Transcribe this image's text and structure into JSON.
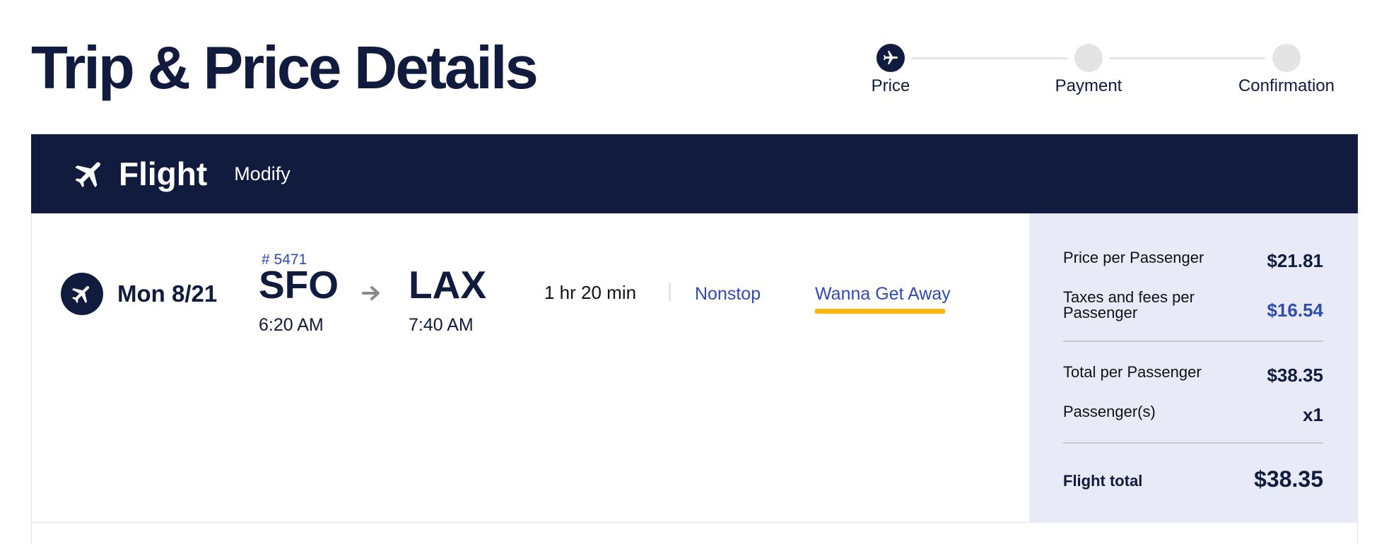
{
  "page": {
    "title": "Trip & Price Details"
  },
  "stepper": {
    "steps": [
      {
        "label": "Price",
        "active": true
      },
      {
        "label": "Payment",
        "active": false
      },
      {
        "label": "Confirmation",
        "active": false
      }
    ]
  },
  "flight_header": {
    "icon": "airplane-icon",
    "title": "Flight",
    "modify_label": "Modify"
  },
  "flight": {
    "date": "Mon 8/21",
    "flight_number": "# 5471",
    "origin": {
      "code": "SFO",
      "time": "6:20 AM"
    },
    "destination": {
      "code": "LAX",
      "time": "7:40 AM"
    },
    "duration": "1 hr 20 min",
    "stops": "Nonstop",
    "fare_class": "Wanna Get Away"
  },
  "price_summary": {
    "price_per_passenger_label": "Price per Passenger",
    "price_per_passenger_value": "$21.81",
    "taxes_label_line1": "Taxes and fees per",
    "taxes_label_line2": "Passenger",
    "taxes_value": "$16.54",
    "total_per_passenger_label": "Total per Passenger",
    "total_per_passenger_value": "$38.35",
    "passengers_label": "Passenger(s)",
    "passengers_value": "x1",
    "flight_total_label": "Flight total",
    "flight_total_value": "$38.35"
  },
  "colors": {
    "navy": "#111b3d",
    "link_blue": "#304cb2",
    "fare_underline": "#f9b612",
    "panel_bg": "#e8eaf7"
  }
}
